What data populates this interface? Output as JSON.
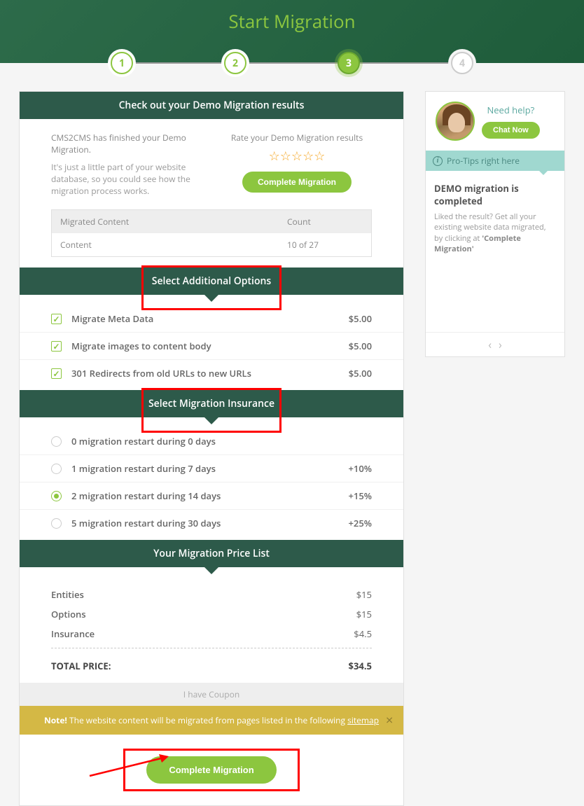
{
  "header": {
    "title": "Start Migration"
  },
  "steps": [
    "1",
    "2",
    "3",
    "4"
  ],
  "demoSection": {
    "header": "Check out your Demo Migration results",
    "line1": "CMS2CMS has finished your Demo Migration.",
    "line2": "It's just a little part of your website database, so you could see how the migration process works.",
    "rateLabel": "Rate your Demo Migration results",
    "cta": "Complete Migration",
    "tableHeaders": {
      "col1": "Migrated Content",
      "col2": "Count"
    },
    "tableRow": {
      "col1": "Content",
      "col2": "10 of 27"
    }
  },
  "optionsSection": {
    "header": "Select Additional Options",
    "items": [
      {
        "label": "Migrate Meta Data",
        "price": "$5.00"
      },
      {
        "label": "Migrate images to content body",
        "price": "$5.00"
      },
      {
        "label": "301 Redirects from old URLs to new URLs",
        "price": "$5.00"
      }
    ]
  },
  "insuranceSection": {
    "header": "Select Migration Insurance",
    "items": [
      {
        "label": "0 migration restart during 0 days",
        "price": ""
      },
      {
        "label": "1 migration restart during 7 days",
        "price": "+10%"
      },
      {
        "label": "2 migration restart during 14 days",
        "price": "+15%"
      },
      {
        "label": "5 migration restart during 30 days",
        "price": "+25%"
      }
    ]
  },
  "priceSection": {
    "header": "Your Migration Price List",
    "rows": [
      {
        "label": "Entities",
        "val": "$15"
      },
      {
        "label": "Options",
        "val": "$15"
      },
      {
        "label": "Insurance",
        "val": "$4.5"
      }
    ],
    "totalLabel": "TOTAL PRICE:",
    "totalVal": "$34.5"
  },
  "coupon": "I have Coupon",
  "note": {
    "bold": "Note!",
    "text": " The website content will be migrated from pages listed in the following ",
    "link": "sitemap"
  },
  "cta": "Complete Migration",
  "sidebar": {
    "help": "Need help?",
    "chat": "Chat Now",
    "tipsBar": "Pro-Tips right here",
    "tipTitle": "DEMO migration is completed",
    "tipText": "Liked the result? Get all your existing website data migrated, by clicking at ",
    "tipBold": "'Complete Migration'"
  }
}
